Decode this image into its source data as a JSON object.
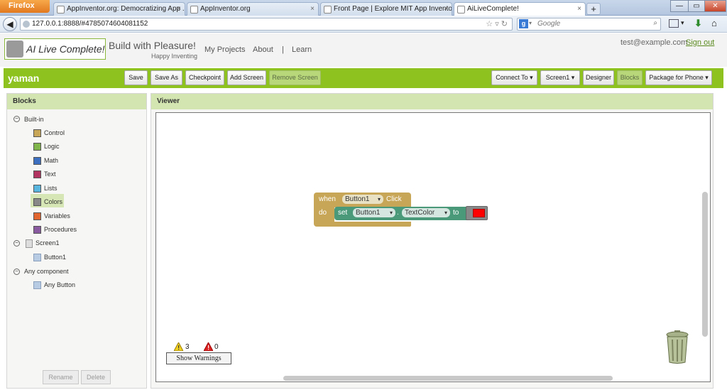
{
  "browser": {
    "menu_button": "Firefox",
    "tabs": [
      {
        "title": "AppInventor.org: Democratizing App ...",
        "close": "×"
      },
      {
        "title": "AppInventor.org",
        "close": "×"
      },
      {
        "title": "Front Page | Explore MIT App Inventor",
        "close": "×"
      },
      {
        "title": "AiLiveComplete!",
        "close": "×"
      }
    ],
    "new_tab": "+",
    "window_buttons": [
      "—",
      "▭",
      "✕"
    ],
    "url": "127.0.0.1:8888/#4785074604081152",
    "search_placeholder": "Google",
    "search_engine_letter": "g"
  },
  "header": {
    "logo_text": "AI Live Complete!",
    "tagline": "Build with Pleasure!",
    "tagline_sub": "Happy Inventing",
    "nav": [
      "My Projects",
      "About",
      "|",
      "Learn"
    ],
    "user_email": "test@example.com",
    "signout": "Sign out"
  },
  "toolbar": {
    "project_name": "yaman",
    "left_buttons": [
      "Save",
      "Save As",
      "Checkpoint",
      "Add Screen",
      "Remove Screen"
    ],
    "right_buttons": [
      "Connect To ▾",
      "Screen1 ▾",
      "Designer",
      "Blocks",
      "Package for Phone ▾"
    ]
  },
  "blocks_panel": {
    "title": "Blocks",
    "builtin_label": "Built-in",
    "builtin": [
      {
        "label": "Control",
        "color": "#c8a657"
      },
      {
        "label": "Logic",
        "color": "#7fb54a"
      },
      {
        "label": "Math",
        "color": "#3c6fc0"
      },
      {
        "label": "Text",
        "color": "#b0345f"
      },
      {
        "label": "Lists",
        "color": "#58b6de"
      },
      {
        "label": "Colors",
        "color": "#888888"
      },
      {
        "label": "Variables",
        "color": "#e0652e"
      },
      {
        "label": "Procedures",
        "color": "#8a5aa0"
      }
    ],
    "screen_label": "Screen1",
    "screen_child": "Button1",
    "any_label": "Any component",
    "any_child": "Any Button",
    "rename": "Rename",
    "delete": "Delete"
  },
  "viewer": {
    "title": "Viewer",
    "event_block": {
      "when": "when",
      "component": "Button1",
      "event": "Click",
      "do": "do",
      "set": "set",
      "target": "Button1",
      "property": "TextColor",
      "to": "to",
      "event_color": "#c8a657",
      "setter_color": "#4a9a7a",
      "color_value": "#ff0000"
    },
    "warnings_count": "3",
    "errors_count": "0",
    "show_warnings": "Show Warnings"
  }
}
